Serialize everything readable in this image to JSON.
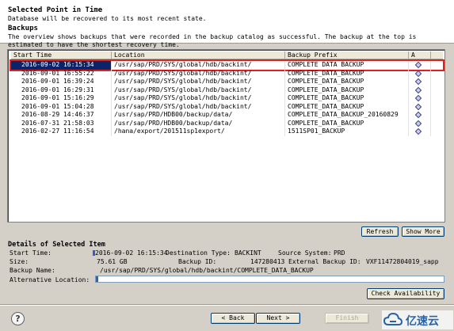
{
  "header": {
    "title": "Selected Point in Time",
    "subtitle": "Database will be recovered to its most recent state.",
    "backups_heading": "Backups",
    "overview_text": "The overview shows backups that were recorded in the backup catalog as successful. The backup at the top is\nestimated to have the shortest recovery time."
  },
  "table": {
    "columns": [
      "Start Time",
      "Location",
      "Backup Prefix",
      "A"
    ],
    "rows": [
      {
        "start_time": "2016-09-02 16:15:34",
        "location": "/usr/sap/PRD/SYS/global/hdb/backint/",
        "prefix": "COMPLETE DATA BACKUP",
        "selected": true
      },
      {
        "start_time": "2016-09-01 16:55:22",
        "location": "/usr/sap/PRD/SYS/global/hdb/backint/",
        "prefix": "COMPLETE_DATA_BACKUP",
        "selected": false
      },
      {
        "start_time": "2016-09-01 16:39:24",
        "location": "/usr/sap/PRD/SYS/global/hdb/backint/",
        "prefix": "COMPLETE_DATA_BACKUP",
        "selected": false
      },
      {
        "start_time": "2016-09-01 16:29:31",
        "location": "/usr/sap/PRD/SYS/global/hdb/backint/",
        "prefix": "COMPLETE_DATA_BACKUP",
        "selected": false
      },
      {
        "start_time": "2016-09-01 15:16:29",
        "location": "/usr/sap/PRD/SYS/global/hdb/backint/",
        "prefix": "COMPLETE_DATA_BACKUP",
        "selected": false
      },
      {
        "start_time": "2016-09-01 15:04:28",
        "location": "/usr/sap/PRD/SYS/global/hdb/backint/",
        "prefix": "COMPLETE_DATA_BACKUP",
        "selected": false
      },
      {
        "start_time": "2016-08-29 14:46:37",
        "location": "/usr/sap/PRD/HDB00/backup/data/",
        "prefix": "COMPLETE_DATA_BACKUP_20160829",
        "selected": false
      },
      {
        "start_time": "2016-07-31 21:58:03",
        "location": "/usr/sap/PRD/HDB00/backup/data/",
        "prefix": "COMPLETE_DATA_BACKUP",
        "selected": false
      },
      {
        "start_time": "2016-02-27 11:16:54",
        "location": "/hana/export/201511sp1export/",
        "prefix": "1511SP01_BACKUP",
        "selected": false
      }
    ]
  },
  "buttons": {
    "refresh": "Refresh",
    "show_more": "Show More",
    "check_availability": "Check Availability",
    "back": "< Back",
    "next": "Next >",
    "finish": "Finish",
    "cancel": "Cancel"
  },
  "details": {
    "heading": "Details of Selected Item",
    "start_time_label": "Start Time:",
    "start_time_value": "2016-09-02 16:15:34",
    "destination_type_label": "Destination Type:",
    "destination_type_value": "BACKINT",
    "source_system_label": "Source System:",
    "source_system_value": "PRD",
    "size_label": "Size:",
    "size_value": "75.61 GB",
    "backup_id_label": "Backup ID:",
    "backup_id_value": "147280413",
    "external_backup_id_label": "External Backup ID:",
    "external_backup_id_value": "VXF11472804019_sapp",
    "backup_name_label": "Backup Name:",
    "backup_name_value": "/usr/sap/PRD/SYS/global/hdb/backint/COMPLETE_DATA_BACKUP",
    "alt_location_label": "Alternative Location:",
    "alt_location_value": ""
  },
  "watermark": {
    "text": "亿速云"
  },
  "icons": {
    "help": "help-icon",
    "row_status": "diamond-icon",
    "watermark_logo": "cloud-logo-icon"
  },
  "colors": {
    "selected_row_bg": "#0a246a",
    "highlight_border": "#e02020",
    "dialog_bg": "#d4d0c8"
  }
}
